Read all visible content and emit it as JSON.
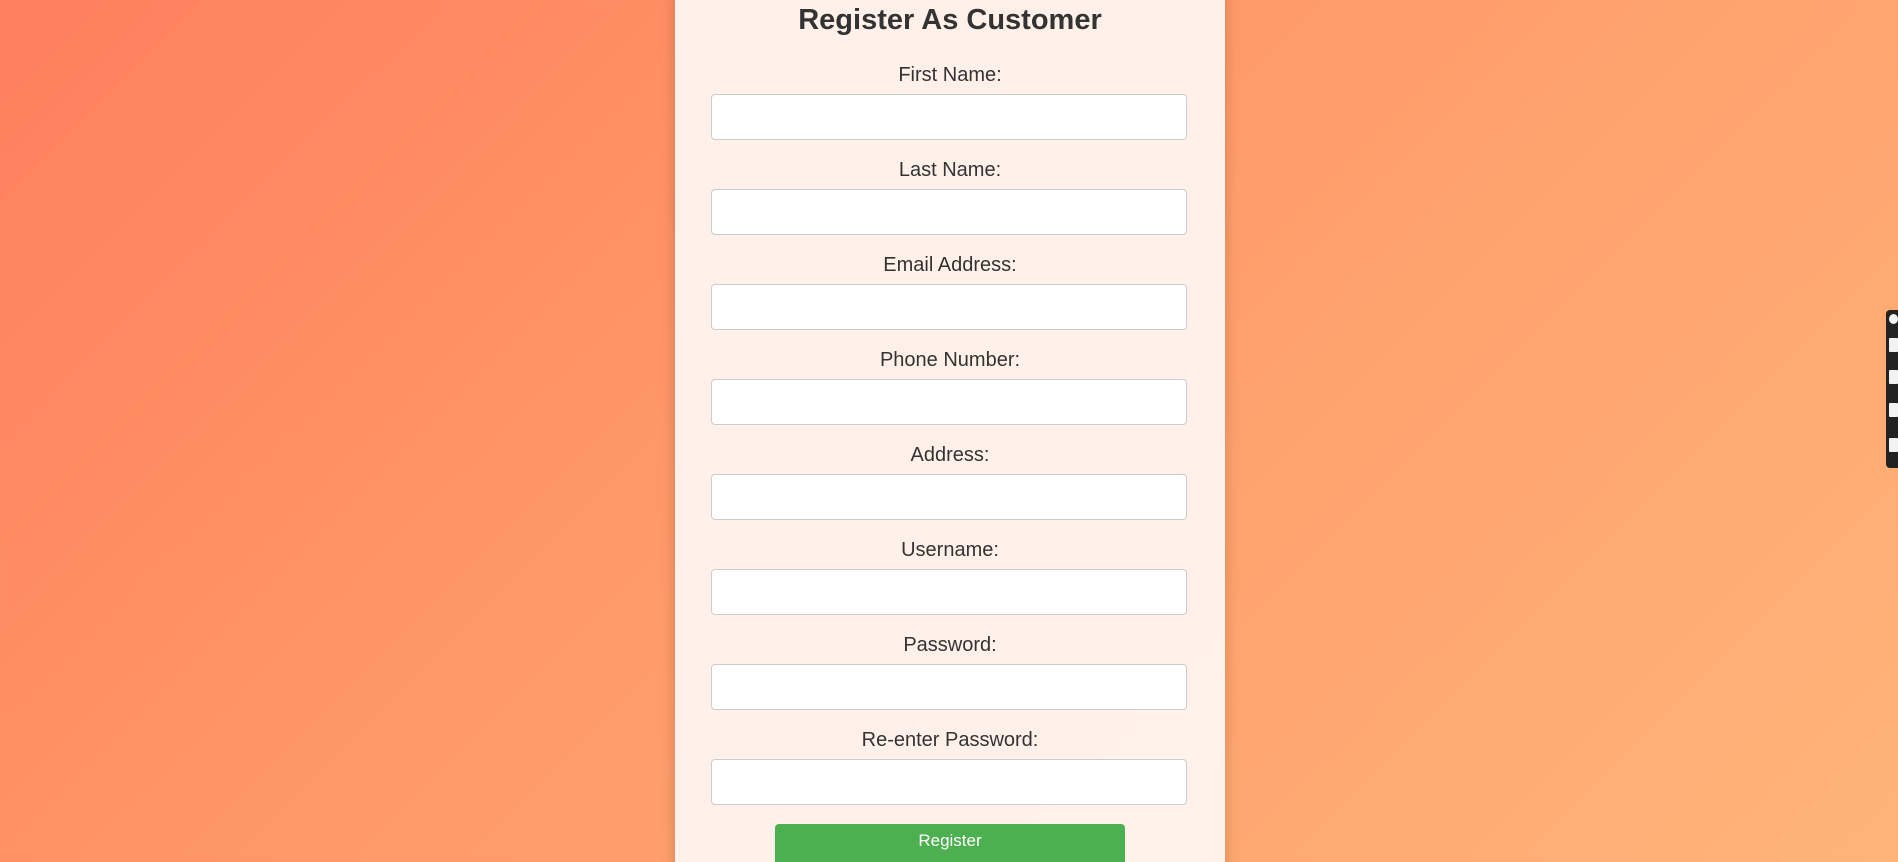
{
  "form": {
    "title": "Register As Customer",
    "fields": [
      {
        "label": "First Name:",
        "value": ""
      },
      {
        "label": "Last Name:",
        "value": ""
      },
      {
        "label": "Email Address:",
        "value": ""
      },
      {
        "label": "Phone Number:",
        "value": ""
      },
      {
        "label": "Address:",
        "value": ""
      },
      {
        "label": "Username:",
        "value": ""
      },
      {
        "label": "Password:",
        "value": ""
      },
      {
        "label": "Re-enter Password:",
        "value": ""
      }
    ],
    "register_label": "Register"
  },
  "side_toolbar": {
    "icons": [
      "settings-icon",
      "tool-icon",
      "tool-icon",
      "copy-icon",
      "close-icon"
    ]
  },
  "colors": {
    "background_start": "#ff7f5e",
    "background_end": "#ffb478",
    "card": "#fff5f0",
    "button": "#4caf50",
    "text": "#333333"
  }
}
